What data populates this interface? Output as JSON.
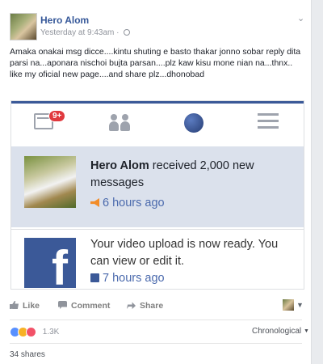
{
  "post": {
    "author": "Hero Alom",
    "timestamp": "Yesterday at 9:43am",
    "separator": "·",
    "privacy_icon": "globe-icon",
    "text_lines": [
      "Amaka onakai msg dicce....kintu shuting e basto thakar jonno sobar reply dita parsi na...aponara nischoi bujta parsan....plz kaw kisu mone nian na...thnx..",
      "like my oficial new page....and share plz...dhonobad"
    ]
  },
  "embedded": {
    "badge": "9+",
    "notifications": [
      {
        "name": "Hero Alom",
        "text": " received 2,000 new messages",
        "time": "6 hours ago",
        "time_icon": "megaphone-icon"
      },
      {
        "text": "Your video upload is now ready. You can view or edit it.",
        "time": "7 hours ago",
        "time_icon": "video-icon"
      }
    ]
  },
  "actions": {
    "like": "Like",
    "comment": "Comment",
    "share": "Share"
  },
  "stats": {
    "reactions_count": "1.3K",
    "ordering": "Chronological",
    "shares": "34 shares"
  },
  "colors": {
    "link": "#365899",
    "facebook_blue": "#3b5998",
    "notification_bg": "#dbe1ec",
    "badge_red": "#e0393e"
  }
}
